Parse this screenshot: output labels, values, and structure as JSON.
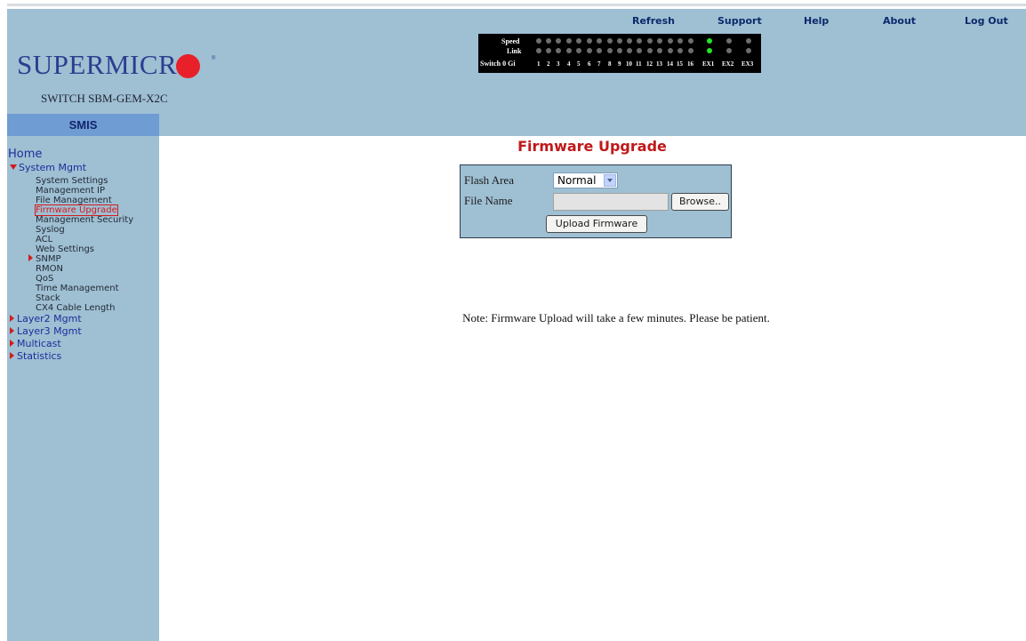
{
  "brand": {
    "logo_text": "SUPERMICR",
    "model": "SWITCH SBM-GEM-X2C",
    "tab": "SMIS",
    "logo_dot_color": "#e8202a"
  },
  "topnav": [
    "Refresh",
    "Support",
    "Help",
    "About",
    "Log Out"
  ],
  "port_panel": {
    "speed_label": "Speed",
    "link_label": "Link",
    "switch_label": "Switch 0 Gi",
    "ports": [
      "1",
      "2",
      "3",
      "4",
      "5",
      "6",
      "7",
      "8",
      "9",
      "10",
      "11",
      "12",
      "13",
      "14",
      "15",
      "16",
      "EX1",
      "EX2",
      "EX3"
    ],
    "speed_on": [
      16
    ],
    "link_on": [
      16
    ]
  },
  "sidebar": {
    "home": "Home",
    "system_mgmt": "System Mgmt",
    "items": [
      "System Settings",
      "Management IP",
      "File Management",
      "Firmware Upgrade",
      "Management Security",
      "Syslog",
      "ACL",
      "Web Settings",
      "SNMP",
      "RMON",
      "QoS",
      "Time Management",
      "Stack",
      "CX4 Cable Length"
    ],
    "selected": "Firmware Upgrade",
    "sections": [
      "Layer2 Mgmt",
      "Layer3 Mgmt",
      "Multicast",
      "Statistics"
    ]
  },
  "main": {
    "title": "Firmware Upgrade",
    "form": {
      "flash_label": "Flash Area",
      "flash_value": "Normal",
      "file_label": "File Name",
      "file_value": "",
      "browse_label": "Browse..",
      "upload_label": "Upload Firmware"
    },
    "note": "Note: Firmware Upload will take a few minutes. Please be patient."
  },
  "colors": {
    "header_bg": "#9fbfd3",
    "title": "#c0181a",
    "nav_link": "#0b2a6a",
    "selected": "#d21b1b"
  }
}
